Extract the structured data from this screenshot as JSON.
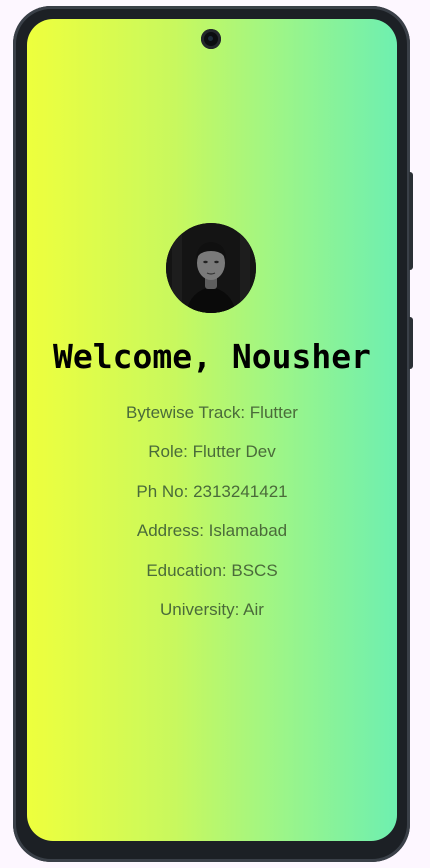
{
  "profile": {
    "welcome": "Welcome, Nousher",
    "avatar_icon": "profile-photo",
    "details": [
      "Bytewise Track: Flutter",
      "Role: Flutter Dev",
      "Ph No: 2313241421",
      "Address: Islamabad",
      "Education: BSCS",
      "University: Air"
    ]
  },
  "theme": {
    "gradient_start": "#eeff3d",
    "gradient_end": "#6eefb0",
    "text_color": "#4a6b3a",
    "title_color": "#000000"
  }
}
